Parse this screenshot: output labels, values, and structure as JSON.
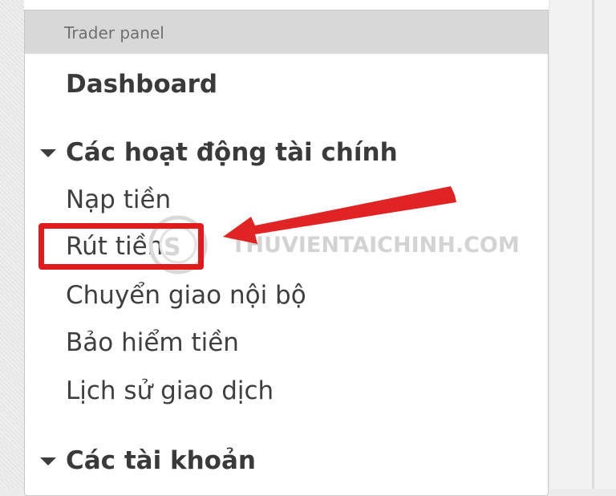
{
  "panel": {
    "header": "Trader panel"
  },
  "menu": {
    "dashboard": "Dashboard",
    "financial_section": "Các hoạt động tài chính",
    "financial_items": [
      "Nạp tiền",
      "Rút tiền",
      "Chuyển giao nội bộ",
      "Bảo hiểm tiền",
      "Lịch sử giao dịch"
    ],
    "accounts_section": "Các tài khoản"
  },
  "annotation": {
    "watermark": "THUVIENTAICHINH.COM",
    "highlight_color": "#e01b1b",
    "icons": [
      "caret-down-icon",
      "red-arrow-icon",
      "watermark-logo-icon"
    ]
  }
}
